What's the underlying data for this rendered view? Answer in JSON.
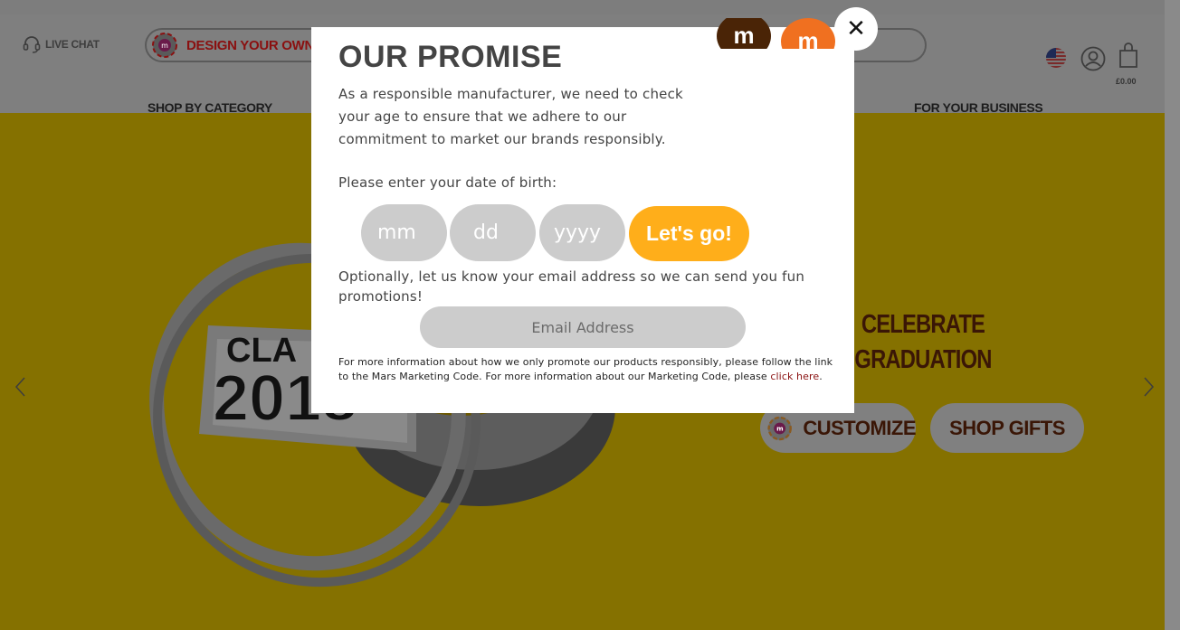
{
  "header": {
    "live_chat": "LIVE CHAT",
    "design_your_own": "DESIGN YOUR OWN",
    "cart_total": "£0.00",
    "nav": [
      "SHOP BY CATEGORY",
      "FOR YOUR BUSINESS"
    ]
  },
  "hero": {
    "headline_line1": "CELEBRATE",
    "headline_line2": "GRADUATION",
    "customize_label": "CUSTOMIZE",
    "shop_gifts_label": "SHOP GIFTS"
  },
  "modal": {
    "title": "OUR PROMISE",
    "intro": "As a responsible manufacturer, we need to check your age to ensure that we adhere to our commitment to market our brands responsibly.",
    "dob_label": "Please enter your date of birth:",
    "dob_month_placeholder": "mm",
    "dob_day_placeholder": "dd",
    "dob_year_placeholder": "yyyy",
    "submit_label": "Let's go!",
    "optional_text": "Optionally, let us know your email address so we can send you fun promotions!",
    "email_placeholder": "Email Address",
    "fineprint": "For more information about how we only promote our products responsibly, please follow the link to the Mars Marketing Code. For more information about our Marketing Code, please ",
    "fineprint_link": "click here",
    "fineprint_end": ".",
    "close_label": "✕"
  },
  "colors": {
    "accent_orange": "#ffae1a",
    "hero_dimmed": "#857100",
    "brand_red": "#8a1010"
  }
}
